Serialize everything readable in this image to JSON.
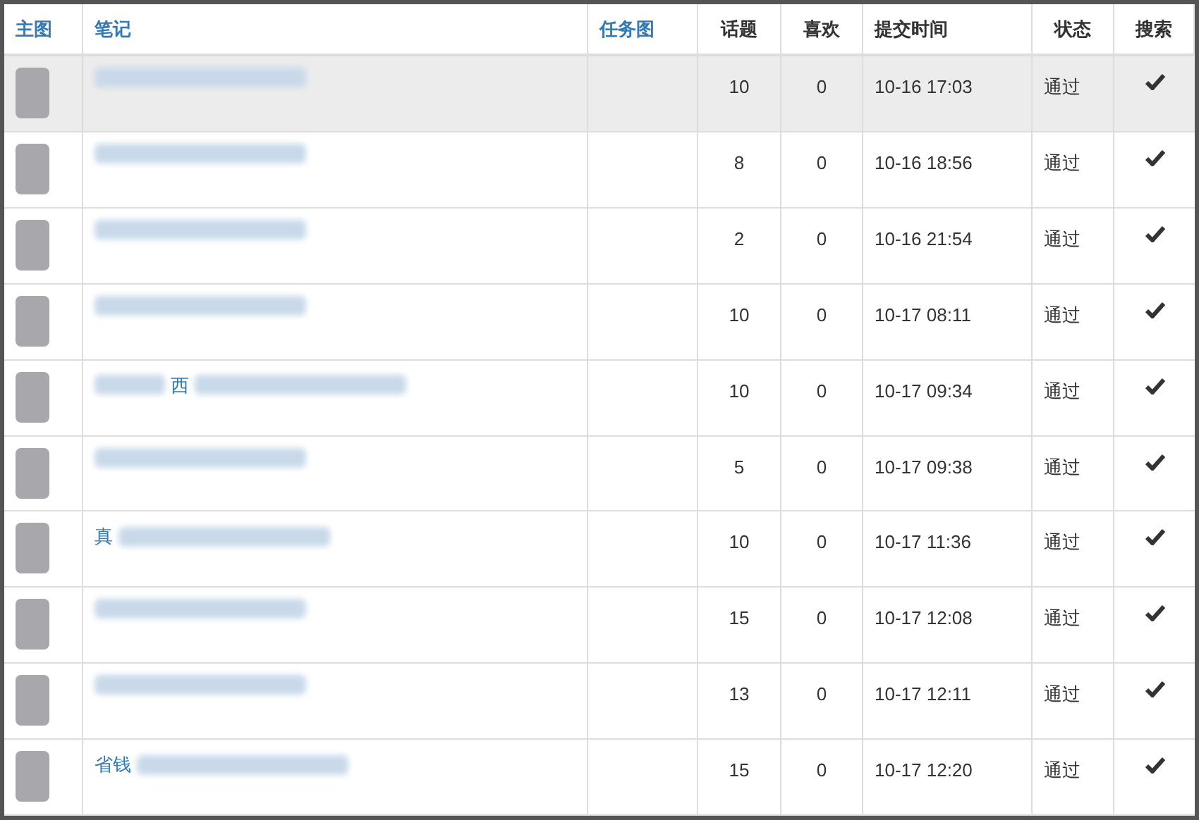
{
  "columns": [
    {
      "label": "主图",
      "kind": "link"
    },
    {
      "label": "笔记",
      "kind": "link"
    },
    {
      "label": "任务图",
      "kind": "link"
    },
    {
      "label": "话题",
      "kind": "plain"
    },
    {
      "label": "喜欢",
      "kind": "plain"
    },
    {
      "label": "提交时间",
      "kind": "plain"
    },
    {
      "label": "状态",
      "kind": "plain"
    },
    {
      "label": "搜索",
      "kind": "plain"
    }
  ],
  "rows": [
    {
      "highlighted": true,
      "topics": "10",
      "likes": "0",
      "submitted": "10-16 17:03",
      "status": "通过",
      "searchable": true
    },
    {
      "highlighted": false,
      "topics": "8",
      "likes": "0",
      "submitted": "10-16 18:56",
      "status": "通过",
      "searchable": true
    },
    {
      "highlighted": false,
      "topics": "2",
      "likes": "0",
      "submitted": "10-16 21:54",
      "status": "通过",
      "searchable": true
    },
    {
      "highlighted": false,
      "topics": "10",
      "likes": "0",
      "submitted": "10-17 08:11",
      "status": "通过",
      "searchable": true
    },
    {
      "highlighted": false,
      "note": "西",
      "kind": "middle",
      "topics": "10",
      "likes": "0",
      "submitted": "10-17 09:34",
      "status": "通过",
      "searchable": true
    },
    {
      "highlighted": false,
      "topics": "5",
      "likes": "0",
      "submitted": "10-17 09:38",
      "status": "通过",
      "searchable": true
    },
    {
      "highlighted": false,
      "note": "真",
      "kind": "start",
      "topics": "10",
      "likes": "0",
      "submitted": "10-17 11:36",
      "status": "通过",
      "searchable": true
    },
    {
      "highlighted": false,
      "topics": "15",
      "likes": "0",
      "submitted": "10-17 12:08",
      "status": "通过",
      "searchable": true
    },
    {
      "highlighted": false,
      "topics": "13",
      "likes": "0",
      "submitted": "10-17 12:11",
      "status": "通过",
      "searchable": true
    },
    {
      "highlighted": false,
      "note": "省钱",
      "kind": "start",
      "topics": "15",
      "likes": "0",
      "submitted": "10-17 12:20",
      "status": "通过",
      "searchable": true
    }
  ]
}
